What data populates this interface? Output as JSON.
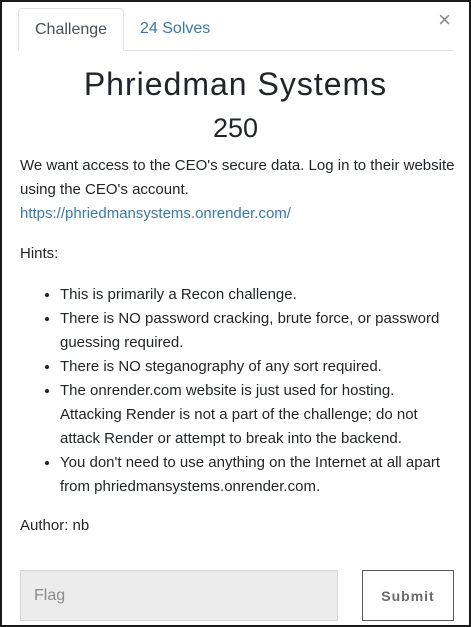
{
  "tabs": [
    {
      "label": "Challenge",
      "active": true
    },
    {
      "label": "24 Solves",
      "active": false
    }
  ],
  "close_glyph": "×",
  "challenge": {
    "name": "Phriedman Systems",
    "value": "250",
    "description": "We want access to the CEO's secure data. Log in to their website using the CEO's account.",
    "link": "https://phriedmansystems.onrender.com/",
    "hints_heading": "Hints:",
    "hints": [
      "This is primarily a Recon challenge.",
      "There is NO password cracking, brute force, or password guessing required.",
      "There is NO steganography of any sort required.",
      "The onrender.com website is just used for hosting. Attacking Render is not a part of the challenge; do not attack Render or attempt to break into the backend.",
      "You don't need to use anything on the Internet at all apart from phriedmansystems.onrender.com."
    ],
    "author": "Author: nb"
  },
  "form": {
    "flag_placeholder": "Flag",
    "flag_value": "",
    "submit_label": "Submit"
  },
  "colors": {
    "link": "#337ab7",
    "input_bg": "#ececec",
    "border": "#1a1a1a"
  },
  "icons": {
    "close": "close-icon"
  }
}
